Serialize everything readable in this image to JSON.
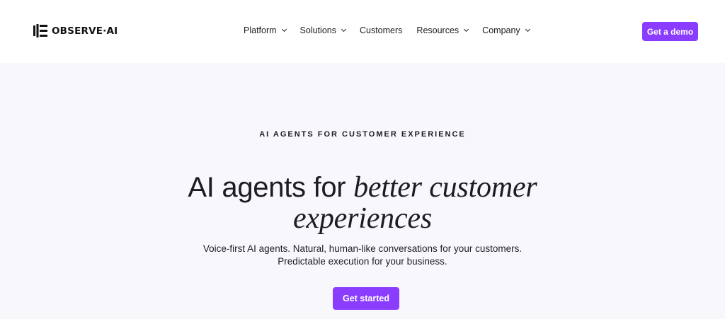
{
  "header": {
    "logo_text": "OBSERVE·AI",
    "logo_icon": "observe-ai-logo-icon",
    "nav": [
      {
        "label": "Platform",
        "has_dropdown": true
      },
      {
        "label": "Solutions",
        "has_dropdown": true
      },
      {
        "label": "Customers",
        "has_dropdown": false
      },
      {
        "label": "Resources",
        "has_dropdown": true
      },
      {
        "label": "Company",
        "has_dropdown": true
      }
    ],
    "cta_label": "Get a demo"
  },
  "hero": {
    "eyebrow": "AI AGENTS FOR CUSTOMER EXPERIENCE",
    "headline_plain": "AI agents for ",
    "headline_italic_1": "better customer",
    "headline_italic_2": "experiences",
    "subtitle_line_1": "Voice-first AI agents. Natural, human-like conversations for your customers.",
    "subtitle_line_2": "Predictable execution for your business.",
    "cta_label": "Get started"
  },
  "colors": {
    "accent": "#8b3dff",
    "hero_background": "#f8f7fc",
    "header_background": "#ffffff",
    "text": "#1c1c22"
  }
}
